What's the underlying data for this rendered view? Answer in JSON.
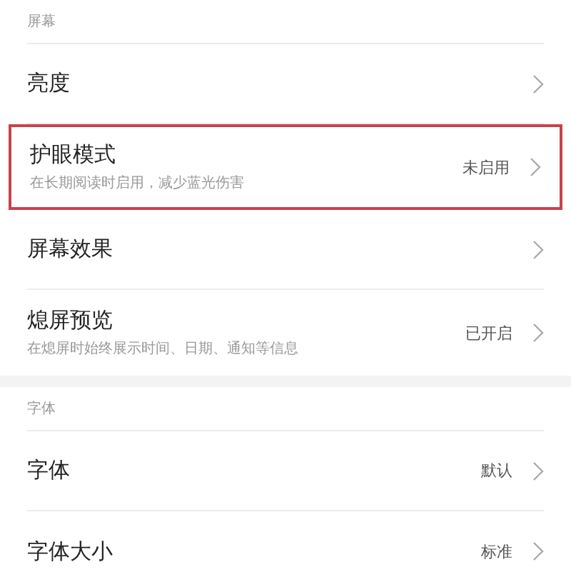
{
  "sections": [
    {
      "title": "屏幕",
      "items": [
        {
          "label": "亮度",
          "highlighted": false
        },
        {
          "label": "护眼模式",
          "description": "在长期阅读时启用，减少蓝光伤害",
          "value": "未启用",
          "highlighted": true
        },
        {
          "label": "屏幕效果",
          "highlighted": false
        },
        {
          "label": "熄屏预览",
          "description": "在熄屏时始终展示时间、日期、通知等信息",
          "value": "已开启",
          "highlighted": false
        }
      ]
    },
    {
      "title": "字体",
      "items": [
        {
          "label": "字体",
          "value": "默认",
          "highlighted": false
        },
        {
          "label": "字体大小",
          "value": "标准",
          "highlighted": false
        }
      ]
    }
  ]
}
